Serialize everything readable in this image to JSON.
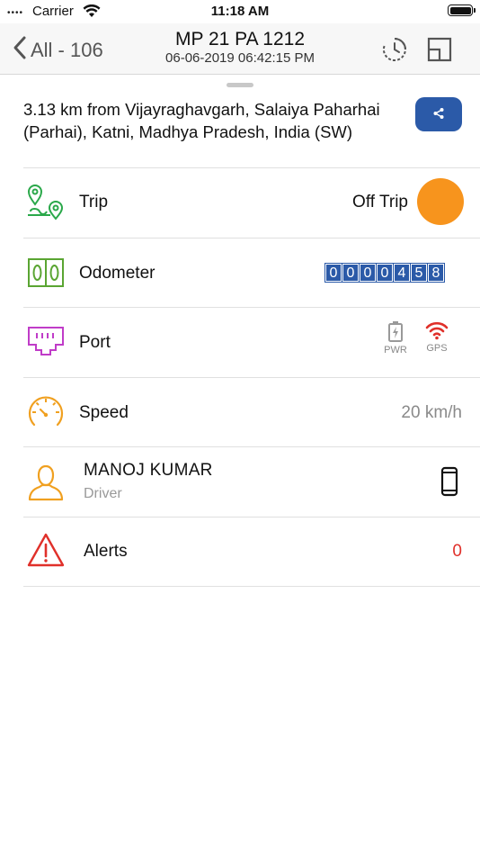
{
  "status_bar": {
    "signal_dots": "••••",
    "carrier": "Carrier",
    "time": "11:18 AM"
  },
  "nav": {
    "back_label": "All - 106",
    "title": "MP 21 PA 1212",
    "subtitle": "06-06-2019 06:42:15 PM",
    "icons": [
      "back-chevron-icon",
      "history-clock-icon",
      "split-view-icon"
    ]
  },
  "location": {
    "address": "3.13 km from Vijayraghavgarh, Salaiya Paharhai (Parhai), Katni, Madhya Pradesh, India (SW)",
    "share_icon": "share-icon"
  },
  "rows": {
    "trip": {
      "label": "Trip",
      "status": "Off Trip",
      "status_color": "#f7941d"
    },
    "odometer": {
      "label": "Odometer",
      "digits": [
        "0",
        "0",
        "0",
        "0",
        "4",
        "5",
        "8"
      ]
    },
    "port": {
      "label": "Port",
      "pwr_label": "PWR",
      "gps_label": "GPS",
      "gps_color": "#e0302a",
      "pwr_color": "#999999"
    },
    "speed": {
      "label": "Speed",
      "value": "20 km/h"
    },
    "driver": {
      "name": "MANOJ KUMAR",
      "role": "Driver"
    },
    "alerts": {
      "label": "Alerts",
      "count": "0",
      "count_color": "#e0302a"
    }
  },
  "colors": {
    "accent_blue": "#2b5aa8",
    "trip_green": "#2aa84a",
    "odometer_green": "#5aa532",
    "port_purple": "#c03cc8",
    "speed_orange": "#f0a020",
    "driver_orange": "#f0a020",
    "alert_red": "#e0302a"
  }
}
